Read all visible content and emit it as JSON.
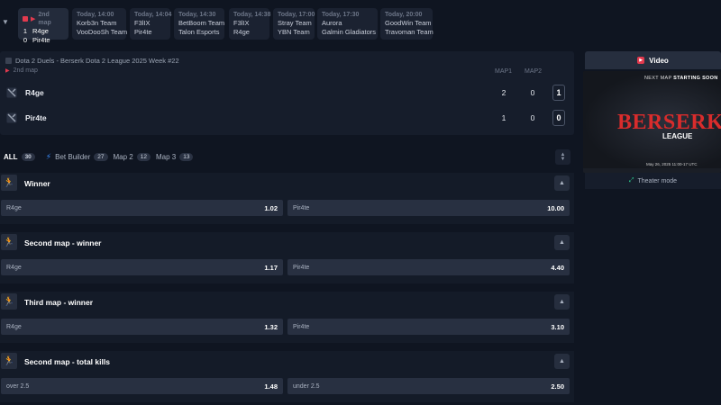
{
  "strip": {
    "live_match": {
      "label": "2nd map",
      "teams": [
        {
          "score": "1",
          "name": "R4ge"
        },
        {
          "score": "0",
          "name": "Pir4te"
        }
      ]
    },
    "matches": [
      {
        "time": "Today, 14:00",
        "team1": "Korb3n Team",
        "team2": "VooDooSh Team"
      },
      {
        "time": "Today, 14:04",
        "team1": "F3lIX",
        "team2": "Pir4te"
      },
      {
        "time": "Today, 14:30",
        "team1": "BetBoom Team",
        "team2": "Talon Esports"
      },
      {
        "time": "Today, 14:38",
        "team1": "F3lIX",
        "team2": "R4ge"
      },
      {
        "time": "Today, 17:00",
        "team1": "Stray Team",
        "team2": "YBN Team"
      },
      {
        "time": "Today, 17:30",
        "team1": "Aurora",
        "team2": "Galmin Gladiators"
      },
      {
        "time": "Today, 20:00",
        "team1": "GoodWin Team",
        "team2": "Travoman Team"
      }
    ]
  },
  "scoreboard": {
    "title": "Dota 2 Duels - Berserk Dota 2 League 2025 Week #22",
    "subtitle": "2nd map",
    "columns": [
      "MAP1",
      "MAP2"
    ],
    "teams": [
      {
        "name": "R4ge",
        "map1": "2",
        "map2": "0",
        "total": "1"
      },
      {
        "name": "Pir4te",
        "map1": "1",
        "map2": "0",
        "total": "0"
      }
    ]
  },
  "tabs": [
    {
      "label": "ALL",
      "count": "30"
    },
    {
      "label": "Bet Builder",
      "count": "27"
    },
    {
      "label": "Map 2",
      "count": "12"
    },
    {
      "label": "Map 3",
      "count": "13"
    }
  ],
  "markets": [
    {
      "title": "Winner",
      "odds": [
        {
          "label": "R4ge",
          "value": "1.02"
        },
        {
          "label": "Pir4te",
          "value": "10.00"
        }
      ]
    },
    {
      "title": "Second map - winner",
      "odds": [
        {
          "label": "R4ge",
          "value": "1.17"
        },
        {
          "label": "Pir4te",
          "value": "4.40"
        }
      ]
    },
    {
      "title": "Third map - winner",
      "odds": [
        {
          "label": "R4ge",
          "value": "1.32"
        },
        {
          "label": "Pir4te",
          "value": "3.10"
        }
      ]
    },
    {
      "title": "Second map - total kills",
      "odds": [
        {
          "label": "over 2.5",
          "value": "1.48"
        },
        {
          "label": "under 2.5",
          "value": "2.50"
        }
      ]
    }
  ],
  "video": {
    "header": "Video",
    "frame_top_prefix": "NEXT MAP",
    "frame_top_main": "STARTING SOON",
    "logo": "BERSERK",
    "league": "LEAGUE",
    "frame_bottom": "May 26, 2025 11:00-17 UTC",
    "theater_label": "Theater mode"
  },
  "colors": {
    "live": "#e23a4e",
    "accent": "#3a8dff",
    "theater": "#2cc98c",
    "brand": "#d92c2c"
  }
}
